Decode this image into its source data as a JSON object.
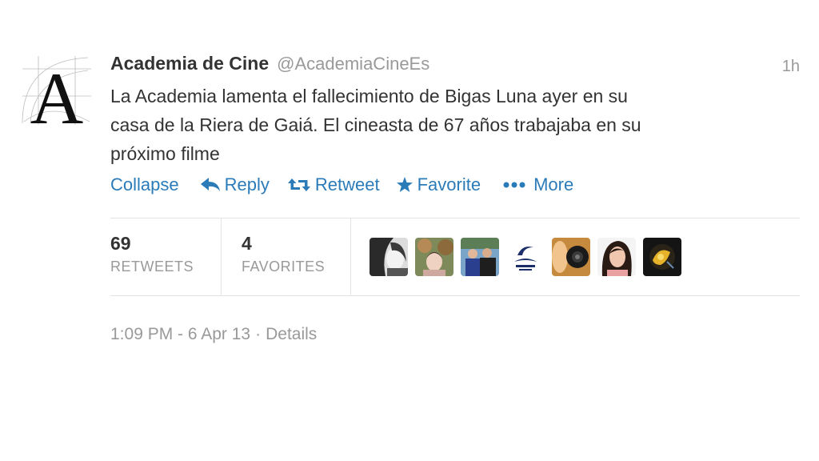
{
  "tweet": {
    "fullname": "Academia de Cine",
    "username": "@AcademiaCineEs",
    "time": "1h",
    "text_lines": [
      "La Academia lamenta el fallecimiento de Bigas Luna ayer en su",
      "casa de la Riera de Gaiá. El cineasta de 67 años trabajaba en su",
      "próximo filme"
    ],
    "avatar_letter": "A"
  },
  "actions": {
    "collapse": "Collapse",
    "reply": "Reply",
    "retweet": "Retweet",
    "favorite": "Favorite",
    "more": "More"
  },
  "stats": {
    "retweets_count": "69",
    "retweets_label": "RETWEETS",
    "favorites_count": "4",
    "favorites_label": "FAVORITES"
  },
  "favoriters": [
    {
      "icon": "user-avatar-1"
    },
    {
      "icon": "user-avatar-2"
    },
    {
      "icon": "user-avatar-3"
    },
    {
      "icon": "user-avatar-4"
    },
    {
      "icon": "user-avatar-5"
    },
    {
      "icon": "user-avatar-6"
    },
    {
      "icon": "user-avatar-7"
    }
  ],
  "footer": {
    "timestamp": "1:09 PM - 6 Apr 13",
    "separator": "·",
    "details": "Details"
  },
  "colors": {
    "link": "#2b7bb9",
    "muted": "#999999",
    "text": "#333333",
    "divider": "#e3e3e3"
  }
}
